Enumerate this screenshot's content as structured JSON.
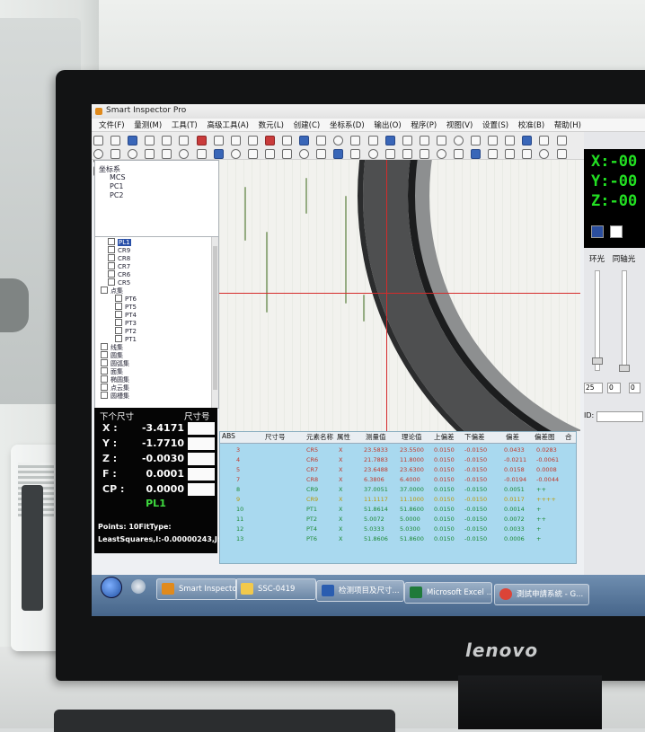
{
  "window": {
    "title": "Smart Inspector Pro",
    "menus": [
      "文件(F)",
      "量测(M)",
      "工具(T)",
      "高级工具(A)",
      "数元(L)",
      "创建(C)",
      "坐标系(D)",
      "输出(O)",
      "程序(P)",
      "视图(V)",
      "设置(S)",
      "校准(B)",
      "帮助(H)"
    ]
  },
  "coord_tree": {
    "root": "坐标系",
    "items": [
      "MCS",
      "PC1",
      "PC2"
    ]
  },
  "element_tree": {
    "items": [
      {
        "label": "PL1",
        "selected": true
      },
      {
        "label": "CR9"
      },
      {
        "label": "CR8"
      },
      {
        "label": "CR7"
      },
      {
        "label": "CR6"
      },
      {
        "label": "CR5"
      },
      {
        "label": "点集"
      },
      {
        "label": "PT6"
      },
      {
        "label": "PT5"
      },
      {
        "label": "PT4"
      },
      {
        "label": "PT3"
      },
      {
        "label": "PT2"
      },
      {
        "label": "PT1"
      },
      {
        "label": "线集"
      },
      {
        "label": "圆集"
      },
      {
        "label": "圆弧集"
      },
      {
        "label": "面集"
      },
      {
        "label": "椭圆集"
      },
      {
        "label": "点云集"
      },
      {
        "label": "圆槽集"
      }
    ]
  },
  "readout": {
    "header_left": "下个尺寸",
    "header_right": "尺寸号",
    "rows": [
      {
        "label": "X :",
        "value": "-3.4171"
      },
      {
        "label": "Y :",
        "value": "-1.7710"
      },
      {
        "label": "Z :",
        "value": "-0.0030"
      },
      {
        "label": "F :",
        "value": "0.0001"
      },
      {
        "label": "CP :",
        "value": "0.0000"
      }
    ],
    "element": "PL1",
    "fit_line1": "Points: 10FitType:",
    "fit_line2": "LeastSquares,I:-0.00000243,J:"
  },
  "coords": {
    "x": "X:-00",
    "y": "Y:-00",
    "z": "Z:-00",
    "accent": "#22e022"
  },
  "light_panel": {
    "ring_light": "环光",
    "coaxial_light": "同轴光",
    "spin1": "25",
    "spin2": "0",
    "spin3": "0",
    "id_label": "ID:"
  },
  "results_table": {
    "headers": [
      "ABS",
      "尺寸号",
      "元素名称",
      "属性",
      "测量值",
      "理论值",
      "上偏差",
      "下偏差",
      "偏差",
      "偏差图",
      "合"
    ],
    "rows": [
      {
        "no": "3",
        "name": "CR5",
        "attr": "X",
        "measured": "23.5833",
        "nominal": "23.5500",
        "upper": "0.0150",
        "lower": "-0.0150",
        "dev": "0.0433",
        "bar": "0.0283",
        "color": "red"
      },
      {
        "no": "4",
        "name": "CR6",
        "attr": "X",
        "measured": "21.7883",
        "nominal": "11.8000",
        "upper": "0.0150",
        "lower": "-0.0150",
        "dev": "-0.0211",
        "bar": "-0.0061",
        "color": "red"
      },
      {
        "no": "5",
        "name": "CR7",
        "attr": "X",
        "measured": "23.6488",
        "nominal": "23.6300",
        "upper": "0.0150",
        "lower": "-0.0150",
        "dev": "0.0158",
        "bar": "0.0008",
        "color": "red"
      },
      {
        "no": "7",
        "name": "CR8",
        "attr": "X",
        "measured": "6.3806",
        "nominal": "6.4000",
        "upper": "0.0150",
        "lower": "-0.0150",
        "dev": "-0.0194",
        "bar": "-0.0044",
        "color": "red"
      },
      {
        "no": "8",
        "name": "CR9",
        "attr": "X",
        "measured": "37.0051",
        "nominal": "37.0000",
        "upper": "0.0150",
        "lower": "-0.0150",
        "dev": "0.0051",
        "bar": "++",
        "color": "green"
      },
      {
        "no": "9",
        "name": "CR9",
        "attr": "X",
        "measured": "11.1117",
        "nominal": "11.1000",
        "upper": "0.0150",
        "lower": "-0.0150",
        "dev": "0.0117",
        "bar": "++++",
        "color": "yellow"
      },
      {
        "no": "10",
        "name": "PT1",
        "attr": "X",
        "measured": "51.8614",
        "nominal": "51.8600",
        "upper": "0.0150",
        "lower": "-0.0150",
        "dev": "0.0014",
        "bar": "+",
        "color": "green"
      },
      {
        "no": "11",
        "name": "PT2",
        "attr": "X",
        "measured": "5.0072",
        "nominal": "5.0000",
        "upper": "0.0150",
        "lower": "-0.0150",
        "dev": "0.0072",
        "bar": "++",
        "color": "green"
      },
      {
        "no": "12",
        "name": "PT4",
        "attr": "X",
        "measured": "5.0333",
        "nominal": "5.0300",
        "upper": "0.0150",
        "lower": "-0.0150",
        "dev": "0.0033",
        "bar": "+",
        "color": "green"
      },
      {
        "no": "13",
        "name": "PT6",
        "attr": "X",
        "measured": "51.8606",
        "nominal": "51.8600",
        "upper": "0.0150",
        "lower": "-0.0150",
        "dev": "0.0006",
        "bar": "+",
        "color": "green"
      }
    ]
  },
  "taskbar": {
    "tasks": [
      {
        "label": "Smart Inspector ...",
        "icon_color": "#e08a1c"
      },
      {
        "label": "SSC-0419",
        "icon_color": "#f2c94c"
      },
      {
        "label": "检测项目及尺寸...",
        "icon_color": "#2a5db0"
      },
      {
        "label": "Microsoft Excel ...",
        "icon_color": "#1f7a3a"
      },
      {
        "label": "測試申請系統 - G...",
        "icon_color": "#db4437"
      }
    ]
  },
  "monitor_brand": "lenovo"
}
